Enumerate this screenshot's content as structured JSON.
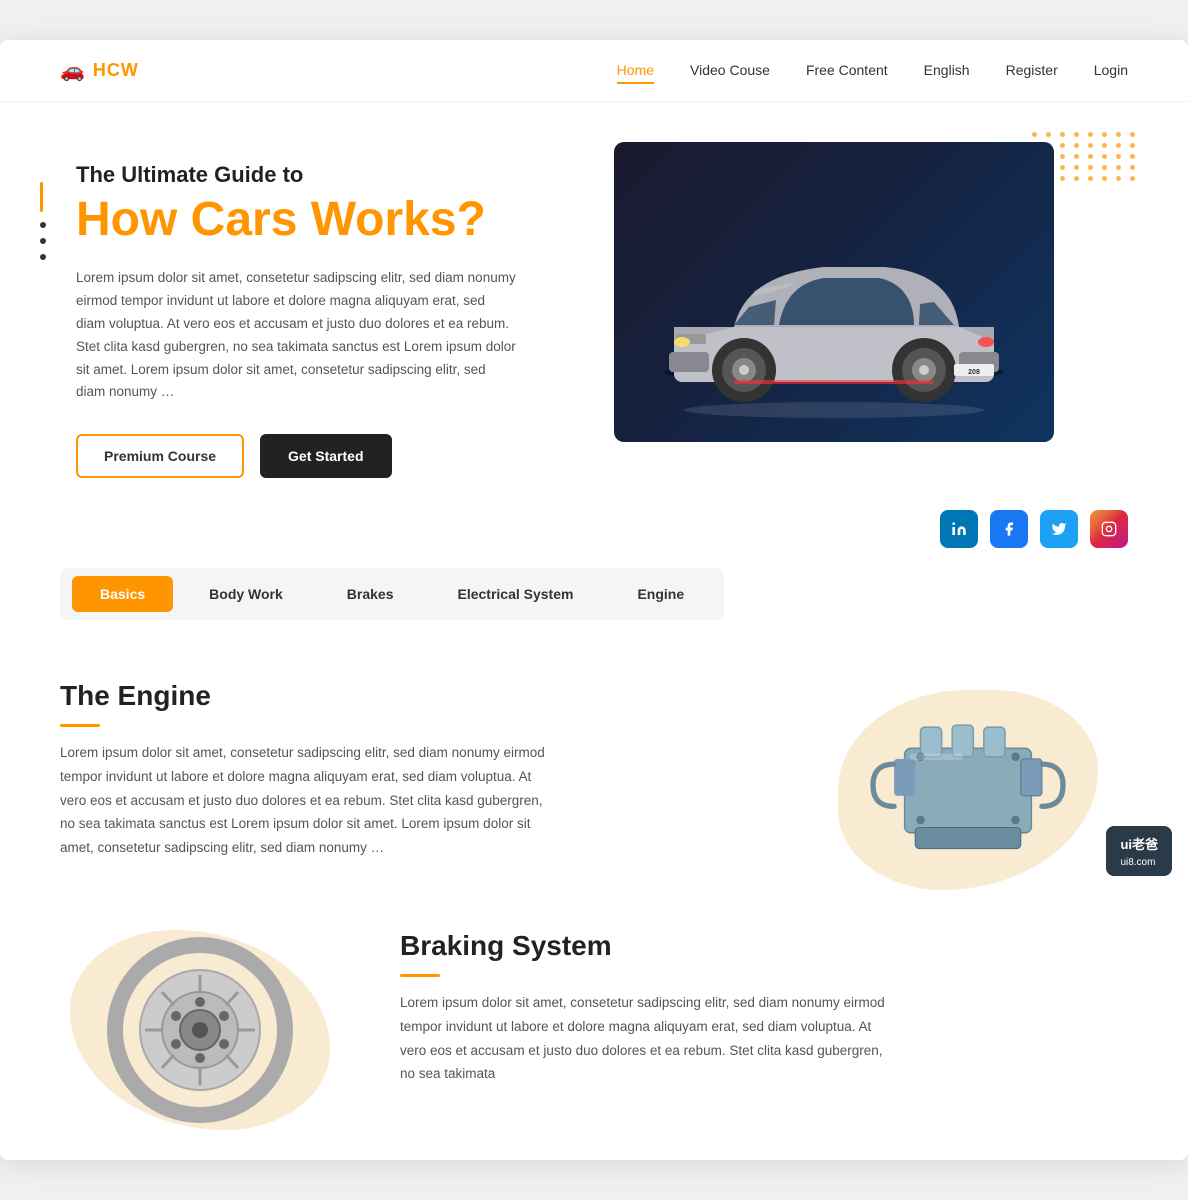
{
  "logo": {
    "icon": "🚗",
    "text": "HCW"
  },
  "nav": {
    "links": [
      {
        "label": "Home",
        "active": true
      },
      {
        "label": "Video Couse",
        "active": false
      },
      {
        "label": "Free Content",
        "active": false
      },
      {
        "label": "English",
        "active": false
      },
      {
        "label": "Register",
        "active": false
      },
      {
        "label": "Login",
        "active": false
      }
    ]
  },
  "hero": {
    "subtitle": "The Ultimate Guide to",
    "title": "How Cars Works?",
    "description": "Lorem ipsum dolor sit amet, consetetur sadipscing elitr, sed diam nonumy eirmod tempor invidunt ut labore et dolore magna aliquyam erat, sed diam voluptua. At vero eos et accusam et justo duo dolores et ea rebum. Stet clita kasd gubergren, no sea takimata sanctus est Lorem ipsum dolor sit amet. Lorem ipsum dolor sit amet, consetetur sadipscing elitr, sed diam nonumy …",
    "btn_premium": "Premium Course",
    "btn_started": "Get Started"
  },
  "social": [
    {
      "name": "linkedin",
      "label": "in",
      "class": "si-linkedin"
    },
    {
      "name": "facebook",
      "label": "f",
      "class": "si-facebook"
    },
    {
      "name": "twitter",
      "label": "t",
      "class": "si-twitter"
    },
    {
      "name": "instagram",
      "label": "ig",
      "class": "si-instagram"
    }
  ],
  "tabs": [
    {
      "label": "Basics",
      "active": true
    },
    {
      "label": "Body Work",
      "active": false
    },
    {
      "label": "Brakes",
      "active": false
    },
    {
      "label": "Electrical System",
      "active": false
    },
    {
      "label": "Engine",
      "active": false
    }
  ],
  "engine_section": {
    "heading": "The Engine",
    "description": "Lorem ipsum dolor sit amet, consetetur sadipscing elitr, sed diam nonumy eirmod tempor invidunt ut labore et dolore magna aliquyam erat, sed diam voluptua. At vero eos et accusam et justo duo dolores et ea rebum. Stet clita kasd gubergren, no sea takimata sanctus est Lorem ipsum dolor sit amet. Lorem ipsum dolor sit amet, consetetur sadipscing elitr, sed diam nonumy …"
  },
  "braking_section": {
    "heading": "Braking System",
    "description": "Lorem ipsum dolor sit amet, consetetur sadipscing elitr, sed diam nonumy eirmod tempor invidunt ut labore et dolore magna aliquyam erat, sed diam voluptua. At vero eos et accusam et justo duo dolores et ea rebum. Stet clita kasd gubergren, no sea takimata"
  },
  "dots_grid_count": 40,
  "colors": {
    "accent": "#ff9500",
    "dark": "#222222",
    "text": "#555555"
  }
}
